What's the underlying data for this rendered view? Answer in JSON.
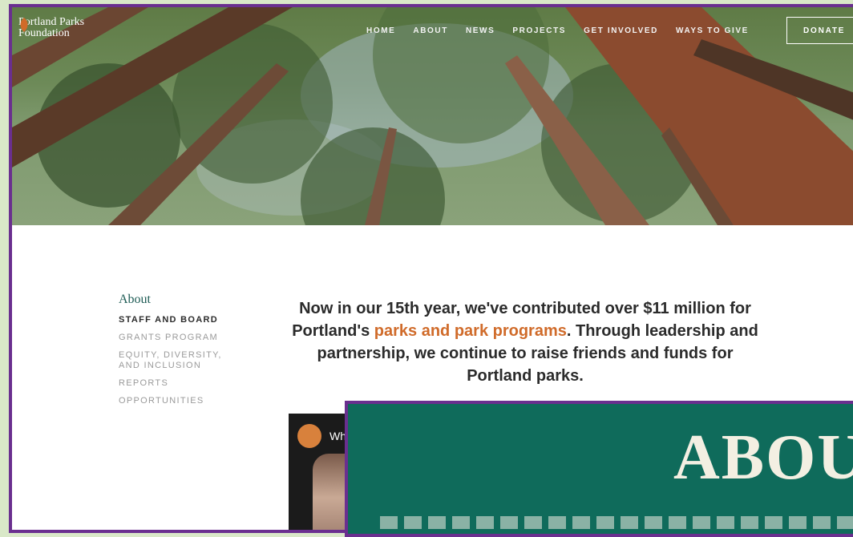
{
  "brand": {
    "line1": "Portland Parks",
    "line2": "Foundation"
  },
  "nav": {
    "items": [
      "HOME",
      "ABOUT",
      "NEWS",
      "PROJECTS",
      "GET INVOLVED",
      "WAYS TO GIVE"
    ],
    "donate": "DONATE"
  },
  "sidebar": {
    "title": "About",
    "items": [
      {
        "label": "STAFF AND BOARD",
        "active": true
      },
      {
        "label": "GRANTS PROGRAM"
      },
      {
        "label": "EQUITY, DIVERSITY,"
      },
      {
        "label": "AND INCLUSION"
      },
      {
        "label": "REPORTS"
      },
      {
        "label": "OPPORTUNITIES"
      }
    ]
  },
  "intro": {
    "part1": "Now in our 15th year, we've contributed over $11 million for Portland's ",
    "highlight": "parks and park programs",
    "part2": ".  Through leadership and partnership, we continue to raise friends and funds for Portland parks."
  },
  "video": {
    "title": "What"
  },
  "about_panel": {
    "heading": "ABOU"
  },
  "colors": {
    "accent": "#d06b2a",
    "teal": "#1e5c55",
    "panel": "#0f6b5b",
    "frame": "#6a2f8f"
  }
}
